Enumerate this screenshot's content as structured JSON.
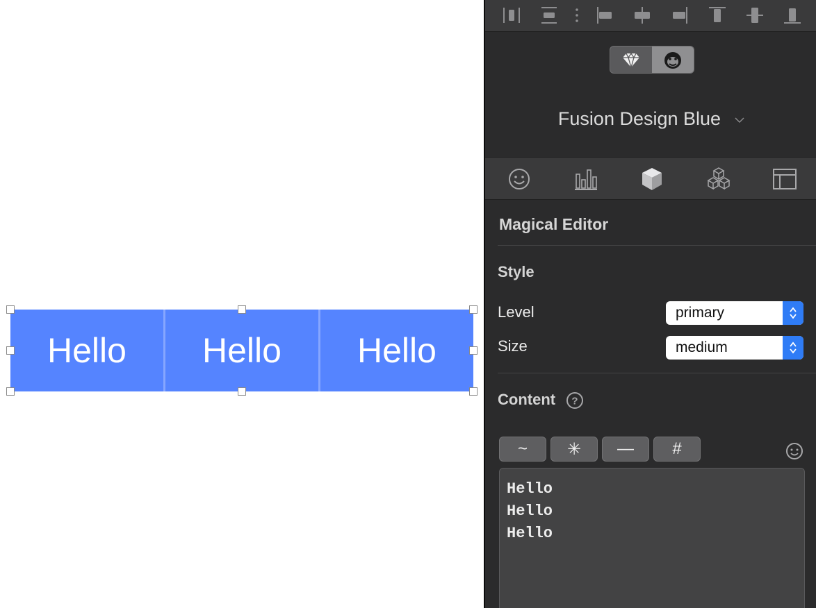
{
  "canvas": {
    "button_group": {
      "labels": [
        "Hello",
        "Hello",
        "Hello"
      ],
      "color": "#5584ff"
    }
  },
  "inspector": {
    "align_toolbar": {
      "icons": [
        "distribute-horizontal-icon",
        "distribute-vertical-icon",
        "more-icon",
        "align-left-icon",
        "align-center-horizontal-icon",
        "align-right-icon",
        "align-top-icon",
        "align-middle-vertical-icon",
        "align-bottom-icon"
      ]
    },
    "mode_toggle": {
      "options": [
        "diamond-icon",
        "gorilla-icon"
      ],
      "active_index": 1
    },
    "theme": "Fusion Design Blue",
    "tabs": [
      "emoji-icon",
      "chart-icon",
      "cube-icon",
      "cubes-icon",
      "layout-icon"
    ],
    "active_tab": "cube-icon",
    "section_title": "Magical Editor",
    "style": {
      "heading": "Style",
      "level_label": "Level",
      "level_value": "primary",
      "size_label": "Size",
      "size_value": "medium"
    },
    "content": {
      "heading": "Content",
      "format_buttons": [
        "~",
        "✳",
        "—",
        "#"
      ],
      "text": "Hello\nHello\nHello"
    },
    "accent_color": "#2f7cf6"
  }
}
